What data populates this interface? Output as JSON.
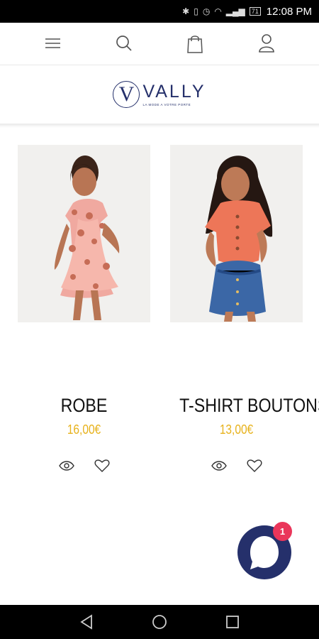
{
  "status_bar": {
    "time": "12:08 PM",
    "battery": "71"
  },
  "nav": {
    "menu_icon": "hamburger-menu-icon",
    "search_icon": "search-icon",
    "bag_icon": "shopping-bag-icon",
    "account_icon": "user-icon"
  },
  "logo": {
    "monogram": "V",
    "name": "VALLY",
    "tagline": "LA MODE A VOTRE PORTE"
  },
  "products": [
    {
      "title": "ROBE",
      "price": "16,00€",
      "image_icon": "child-in-floral-dress-photo"
    },
    {
      "title": "T-SHIRT BOUTONS",
      "price": "13,00€",
      "image_icon": "child-in-coral-top-and-denim-skirt-photo"
    }
  ],
  "chat": {
    "badge_count": "1",
    "icon": "chat-bubble-icon"
  },
  "colors": {
    "brand_navy": "#25306b",
    "price_yellow": "#e7b21c",
    "badge_pink": "#ea365a"
  }
}
